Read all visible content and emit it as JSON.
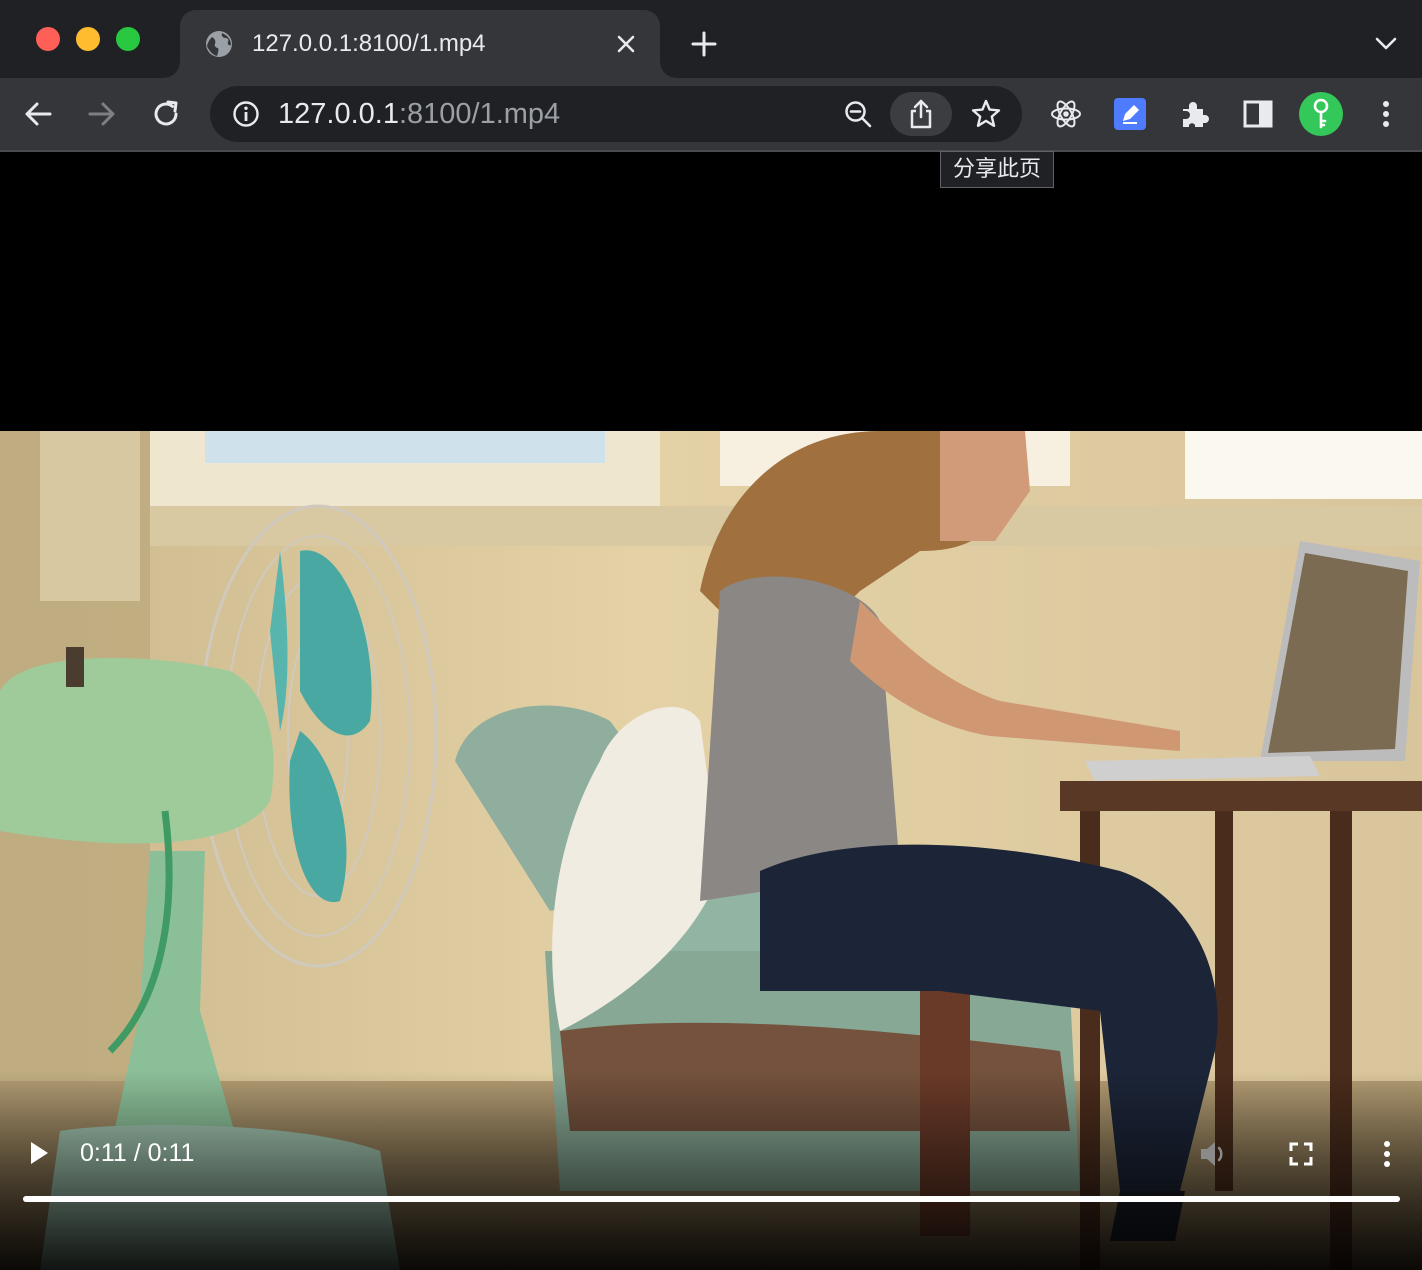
{
  "window": {
    "controls": [
      "close",
      "minimize",
      "zoom"
    ]
  },
  "tab": {
    "title": "127.0.0.1:8100/1.mp4",
    "favicon": "globe-icon"
  },
  "toolbar": {
    "url_host": "127.0.0.1",
    "url_rest": ":8100/1.mp4",
    "tooltip": "分享此页"
  },
  "extensions": [
    "react-devtools-icon",
    "blue-pen-extension-icon",
    "puzzle-extensions-icon",
    "side-panel-icon",
    "profile-key-icon",
    "kebab-menu-icon"
  ],
  "colors": {
    "titlebar": "#202124",
    "toolbar": "#35363a",
    "profile": "#34c759",
    "extension_blue": "#4f7cff"
  },
  "video": {
    "time_display": "0:11 / 0:11",
    "current_time": "0:11",
    "duration": "0:11",
    "progress_fraction": 1.0,
    "state": "paused",
    "muted": true
  }
}
